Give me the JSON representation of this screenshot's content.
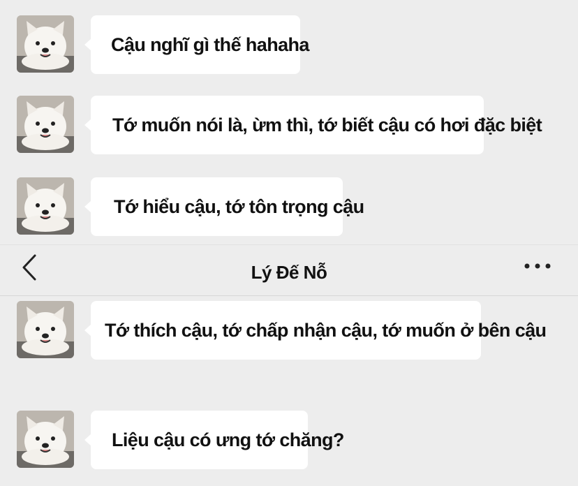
{
  "header": {
    "title": "Lý Đế Nỗ",
    "back_icon": "chevron-left-icon",
    "more_icon": "more-dots-icon"
  },
  "messages": [
    {
      "text": "Cậu nghĩ gì thế hahaha"
    },
    {
      "text": "Tớ muốn nói là, ừm thì, tớ biết  cậu có hơi đặc biệt"
    },
    {
      "text": "Tớ hiểu cậu, tớ tôn trọng cậu"
    },
    {
      "text": "Tớ thích cậu, tớ chấp nhận cậu, tớ muốn ở bên cậu"
    },
    {
      "text": "Liệu cậu có ưng tớ chăng?"
    }
  ],
  "avatar_icon": "samoyed-dog-avatar",
  "colors": {
    "background": "#ededed",
    "bubble": "#ffffff",
    "text": "#111111"
  }
}
